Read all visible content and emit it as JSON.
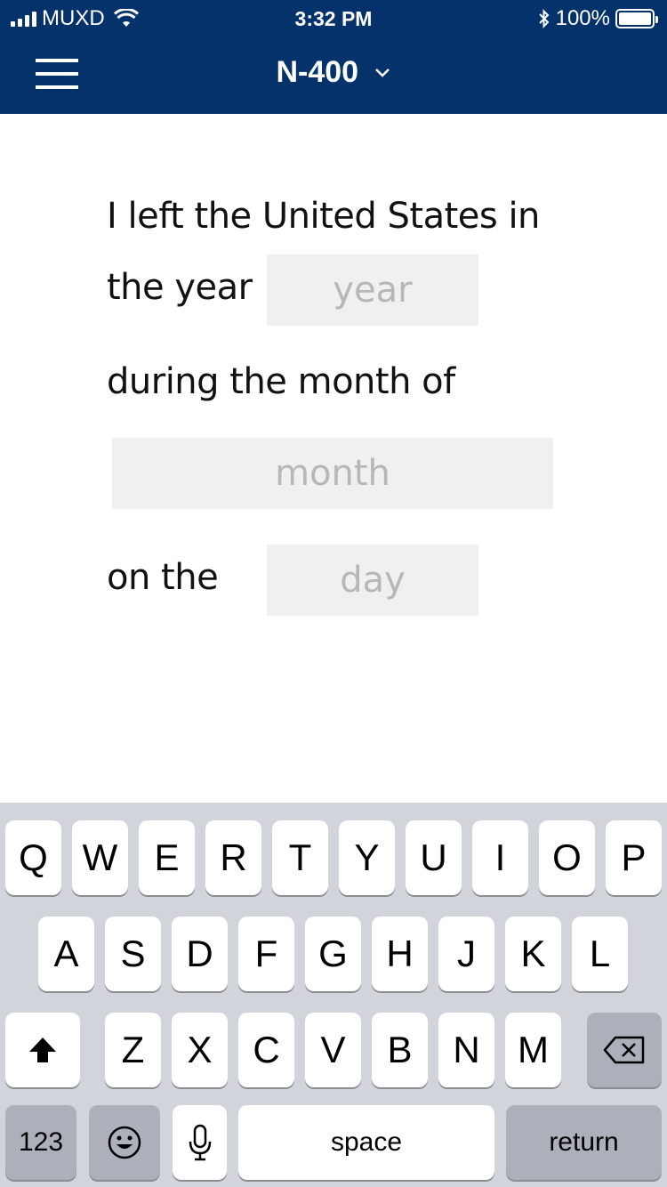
{
  "status_bar": {
    "carrier": "MUXD",
    "time": "3:32 PM",
    "battery": "100%"
  },
  "nav": {
    "title": "N-400",
    "icons": {
      "menu": "hamburger-menu-icon",
      "dropdown": "chevron-down-icon"
    }
  },
  "form": {
    "line1": "I left the United States in",
    "line2_prefix": "the year",
    "year_placeholder": "year",
    "line3": "during the month of",
    "month_placeholder": "month",
    "line4_prefix": "on the",
    "day_placeholder": "day"
  },
  "keyboard": {
    "row1": [
      "Q",
      "W",
      "E",
      "R",
      "T",
      "Y",
      "U",
      "I",
      "O",
      "P"
    ],
    "row2": [
      "A",
      "S",
      "D",
      "F",
      "G",
      "H",
      "J",
      "K",
      "L"
    ],
    "row3": [
      "Z",
      "X",
      "C",
      "V",
      "B",
      "N",
      "M"
    ],
    "numbers_label": "123",
    "space_label": "space",
    "return_label": "return",
    "icons": {
      "shift": "shift-arrow-icon",
      "delete": "backspace-icon",
      "emoji": "emoji-icon",
      "mic": "microphone-icon"
    }
  },
  "colors": {
    "header_bg": "#06326b",
    "field_bg": "#f0f0f0",
    "placeholder": "#b7b7b7",
    "keyboard_bg": "#d1d4da",
    "key_dark": "#abb0ba"
  }
}
